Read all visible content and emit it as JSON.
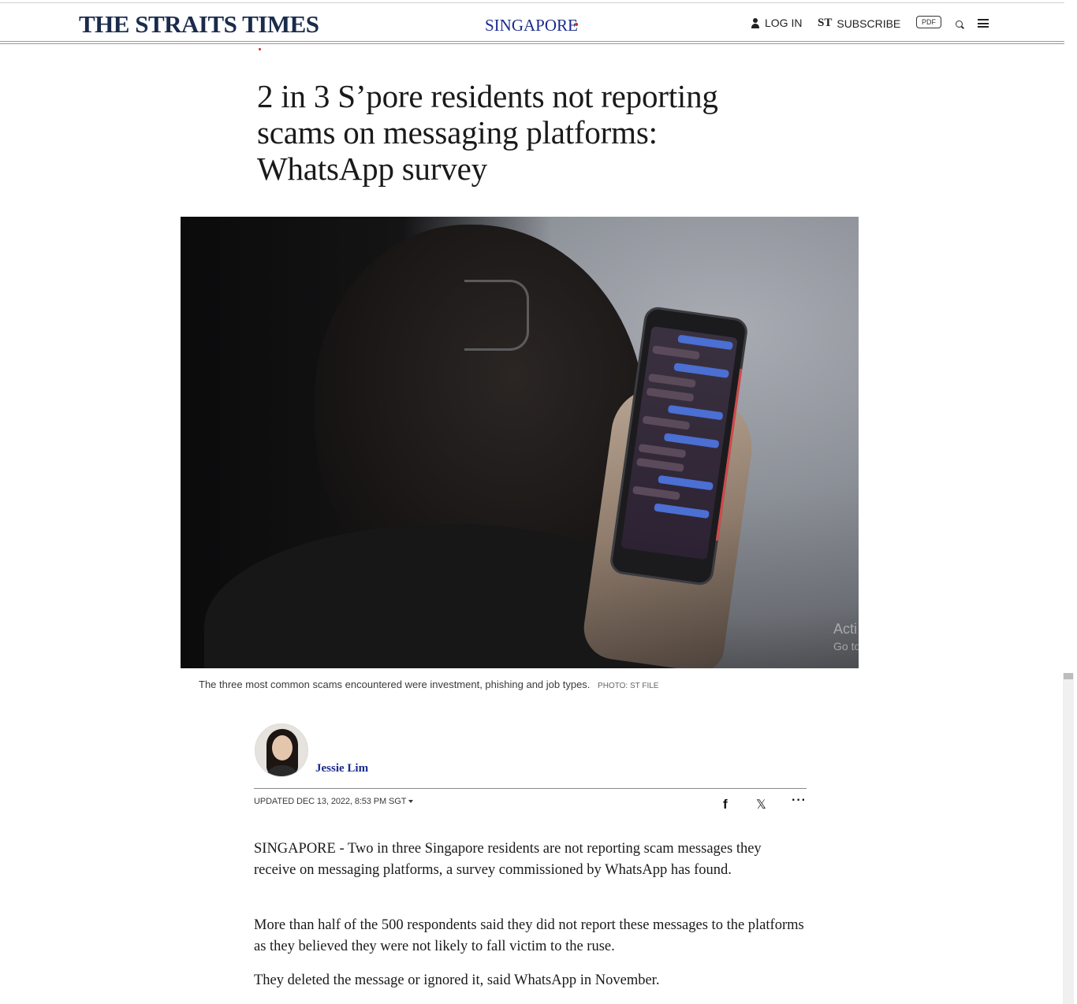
{
  "header": {
    "logo": "THE STRAITS TIMES",
    "section": "SINGAPORE",
    "login_label": "LOG IN",
    "subscribe_mark": "ST",
    "subscribe_label": "SUBSCRIBE",
    "pdf_label": "PDF",
    "icons": [
      "user-icon",
      "search-icon",
      "menu-icon"
    ]
  },
  "article": {
    "headline": "2 in 3 S’pore residents not reporting scams on messaging platforms: WhatsApp survey",
    "photo": {
      "caption": "The three most common scams encountered were investment, phishing and job types.",
      "credit": "PHOTO: ST FILE",
      "watermark_line1": "Acti",
      "watermark_line2": "Go to"
    },
    "byline": {
      "author": "Jessie Lim",
      "updated": "UPDATED DEC 13, 2022, 8:53 PM SGT"
    },
    "share": {
      "facebook": "f",
      "x": "𝕏",
      "more": "···"
    },
    "paragraphs": [
      "SINGAPORE - Two in three Singapore residents are not reporting scam messages they receive on messaging platforms, a survey commissioned by WhatsApp has found.",
      "More than half of the 500 respondents said they did not report these messages to the platforms as they believed they were not likely to fall victim to the ruse.",
      "They deleted the message or ignored it, said WhatsApp in November."
    ]
  },
  "colors": {
    "brand_navy": "#1a2b4c",
    "section_blue": "#1a2b8c",
    "accent_red": "#d81f26"
  }
}
